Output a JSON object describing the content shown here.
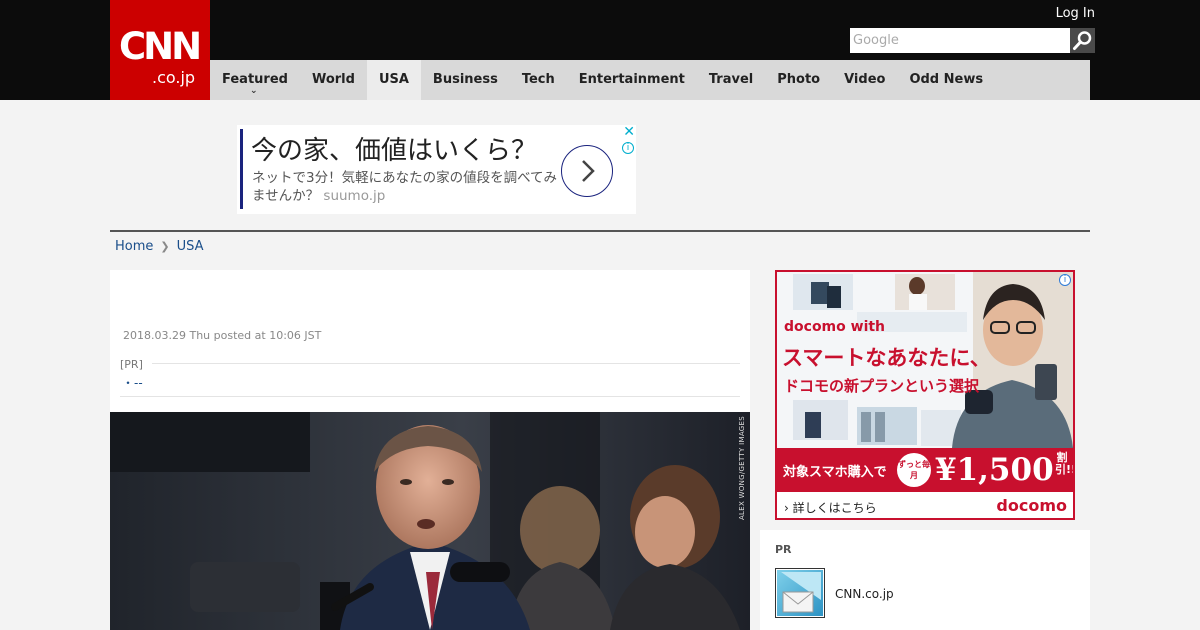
{
  "header": {
    "logo_main": "CNN",
    "logo_sub": ".co.jp",
    "login_label": "Log In",
    "search_placeholder": "Google"
  },
  "nav": {
    "items": [
      {
        "label": "Featured",
        "has_dropdown": true
      },
      {
        "label": "World"
      },
      {
        "label": "USA",
        "active": true
      },
      {
        "label": "Business"
      },
      {
        "label": "Tech"
      },
      {
        "label": "Entertainment"
      },
      {
        "label": "Travel"
      },
      {
        "label": "Photo"
      },
      {
        "label": "Video"
      },
      {
        "label": "Odd News"
      }
    ]
  },
  "top_ad": {
    "headline": "今の家、価値はいくら？",
    "body": "ネットで3分！気軽にあなたの家の値段を調べてみませんか？",
    "domain": "suumo.jp",
    "close_label": "✕",
    "info_label": "i"
  },
  "breadcrumb": {
    "home": "Home",
    "current": "USA"
  },
  "article": {
    "posted": "2018.03.29 Thu posted at 10:06 JST",
    "pr_label": "[PR]",
    "pr_item": "・--",
    "photo_credit": "ALEX WONG/GETTY IMAGES"
  },
  "side_ad": {
    "brand": "docomo with",
    "tagline1": "スマートなあなたに、",
    "tagline2": "ドコモの新プランという選択",
    "promo_text": "対象スマホ購入で",
    "promo_badge": "ずっと毎月",
    "promo_price": "¥1,500",
    "promo_discount": "割引!!!",
    "cta": "詳しくはこちら",
    "logo": "docomo",
    "info_label": "i",
    "accent_color": "#c8102e"
  },
  "pr_box": {
    "title": "PR",
    "item_name": "CNN.co.jp"
  },
  "colors": {
    "header_bg": "#0c0c0c",
    "logo_bg": "#cc0000",
    "nav_bg": "#d9d9d9",
    "link": "#1a4e8a",
    "page_bg": "#f3f3f3"
  }
}
